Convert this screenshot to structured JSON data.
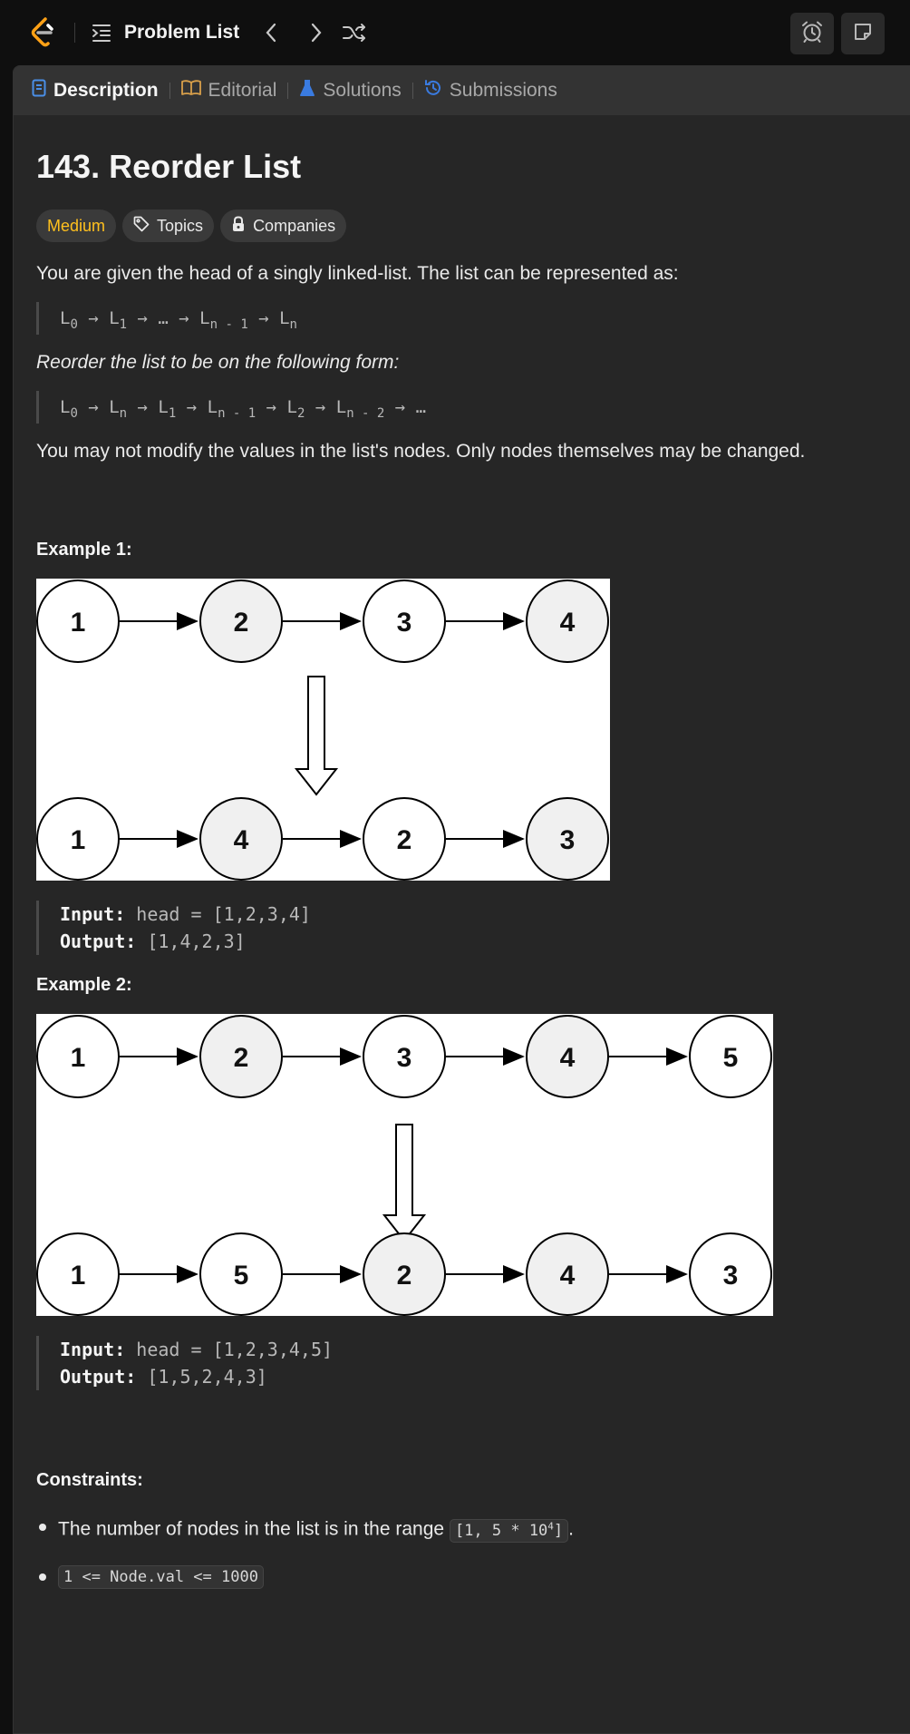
{
  "topbar": {
    "problem_list_label": "Problem List"
  },
  "tabs": [
    {
      "label": "Description"
    },
    {
      "label": "Editorial"
    },
    {
      "label": "Solutions"
    },
    {
      "label": "Submissions"
    }
  ],
  "problem": {
    "title": "143. Reorder List",
    "difficulty": "Medium",
    "topics_label": "Topics",
    "companies_label": "Companies",
    "intro": "You are given the head of a singly linked-list. The list can be represented as:",
    "form_intro": "Reorder the list to be on the following form:",
    "note": "You may not modify the values in the list's nodes. Only nodes themselves may be changed."
  },
  "examples": [
    {
      "heading": "Example 1:",
      "input_label": "Input:",
      "input_value": "head = [1,2,3,4]",
      "output_label": "Output:",
      "output_value": "[1,4,2,3]",
      "top_nodes": [
        "1",
        "2",
        "3",
        "4"
      ],
      "bottom_nodes": [
        "1",
        "4",
        "2",
        "3"
      ]
    },
    {
      "heading": "Example 2:",
      "input_label": "Input:",
      "input_value": "head = [1,2,3,4,5]",
      "output_label": "Output:",
      "output_value": "[1,5,2,4,3]",
      "top_nodes": [
        "1",
        "2",
        "3",
        "4",
        "5"
      ],
      "bottom_nodes": [
        "1",
        "5",
        "2",
        "4",
        "3"
      ]
    }
  ],
  "constraints": {
    "heading": "Constraints:",
    "item1_text": "The number of nodes in the list is in the range",
    "item1_code_pre": "[1, 5 * 10",
    "item1_code_sup": "4",
    "item1_code_post": "]",
    "item1_tail": ".",
    "item2_code": "1 <= Node.val <= 1000"
  },
  "colors": {
    "difficulty_medium": "#ffc01e",
    "description_icon": "#4a8fe7",
    "editorial_icon": "#d9a04a",
    "solutions_icon": "#3a7be0",
    "submissions_icon": "#3a7be0"
  }
}
